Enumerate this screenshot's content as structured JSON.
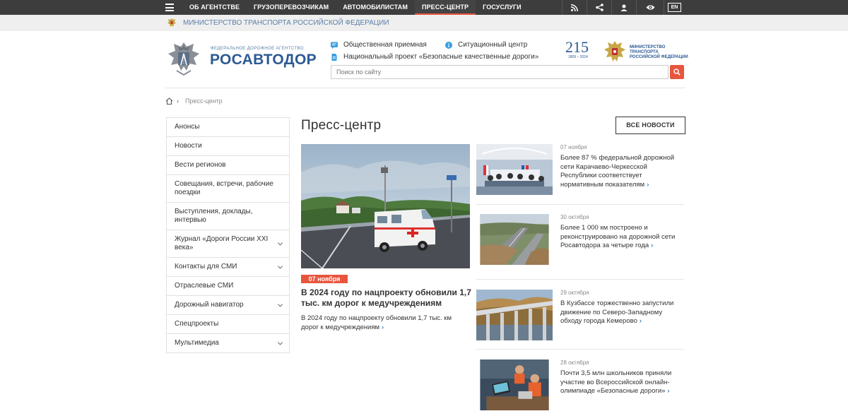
{
  "topnav": {
    "items": [
      {
        "label": "ОБ АГЕНТСТВЕ",
        "active": false
      },
      {
        "label": "ГРУЗОПЕРЕВОЗЧИКАМ",
        "active": false
      },
      {
        "label": "АВТОМОБИЛИСТАМ",
        "active": false
      },
      {
        "label": "ПРЕСС-ЦЕНТР",
        "active": true
      },
      {
        "label": "ГОСУСЛУГИ",
        "active": false
      }
    ],
    "tools": [
      "rss-icon",
      "share-icon",
      "user-icon",
      "eye-icon"
    ],
    "lang": "EN"
  },
  "ministry_bar": {
    "text": "МИНИСТЕРСТВО ТРАНСПОРТА РОССИЙСКОЙ ФЕДЕРАЦИИ"
  },
  "header": {
    "logo_small": "ФЕДЕРАЛЬНОЕ ДОРОЖНОЕ АГЕНТСТВО",
    "logo_big": "РОСАВТОДОР",
    "links": [
      {
        "label": "Общественная приемная",
        "icon": "chat-icon"
      },
      {
        "label": "Ситуационный центр",
        "icon": "info-icon"
      },
      {
        "label": "Национальный проект «Безопасные качественные дороги»",
        "icon": "document-icon"
      }
    ],
    "search_placeholder": "Поиск по сайту",
    "anniversary_number": "215",
    "anniversary_years": "1809 – 2024",
    "ministry_logo_text": "МИНИСТЕРСТВО ТРАНСПОРТА РОССИЙСКОЙ ФЕДЕРАЦИИ"
  },
  "breadcrumb": {
    "current": "Пресс-центр"
  },
  "sidebar": {
    "items": [
      {
        "label": "Анонсы",
        "expandable": false
      },
      {
        "label": "Новости",
        "expandable": false
      },
      {
        "label": "Вести регионов",
        "expandable": false
      },
      {
        "label": "Совещания, встречи, рабочие поездки",
        "expandable": false
      },
      {
        "label": "Выступления, доклады, интервью",
        "expandable": false
      },
      {
        "label": "Журнал «Дороги России XXI века»",
        "expandable": true
      },
      {
        "label": "Контакты для СМИ",
        "expandable": true
      },
      {
        "label": "Отраслевые СМИ",
        "expandable": false
      },
      {
        "label": "Дорожный навигатор",
        "expandable": true
      },
      {
        "label": "Спецпроекты",
        "expandable": false
      },
      {
        "label": "Мультимедиа",
        "expandable": true
      }
    ]
  },
  "main": {
    "title": "Пресс-центр",
    "all_news_button": "ВСЕ НОВОСТИ",
    "featured": {
      "date": "07 ноября",
      "title": "В 2024 году по нацпроекту обновили 1,7 тыс. км дорог к медучреждениям",
      "description": "В 2024 году по нацпроекту обновили 1,7 тыс. км дорог к медучреждениям"
    },
    "news": [
      {
        "date": "07 ноября",
        "title": "Более 87 % федеральной дорожной сети Карачаево-Черкесской Республики соответствует нормативным показателям"
      },
      {
        "date": "30 октября",
        "title": "Более 1 000 км построено и реконструировано на дорожной сети Росавтодора за четыре года"
      },
      {
        "date": "29 октября",
        "title": "В Кузбассе торжественно запустили движение по Северо-Западному обходу города Кемерово"
      },
      {
        "date": "28 октября",
        "title": "Почти 3,5 млн школьников приняли участие во Всероссийской онлайн-олимпиаде «Безопасные дороги»"
      }
    ]
  },
  "colors": {
    "accent": "#e8553e",
    "brand": "#2d5a94",
    "topbar": "#3d3d3d",
    "link_arrow": "#3c80c0"
  }
}
